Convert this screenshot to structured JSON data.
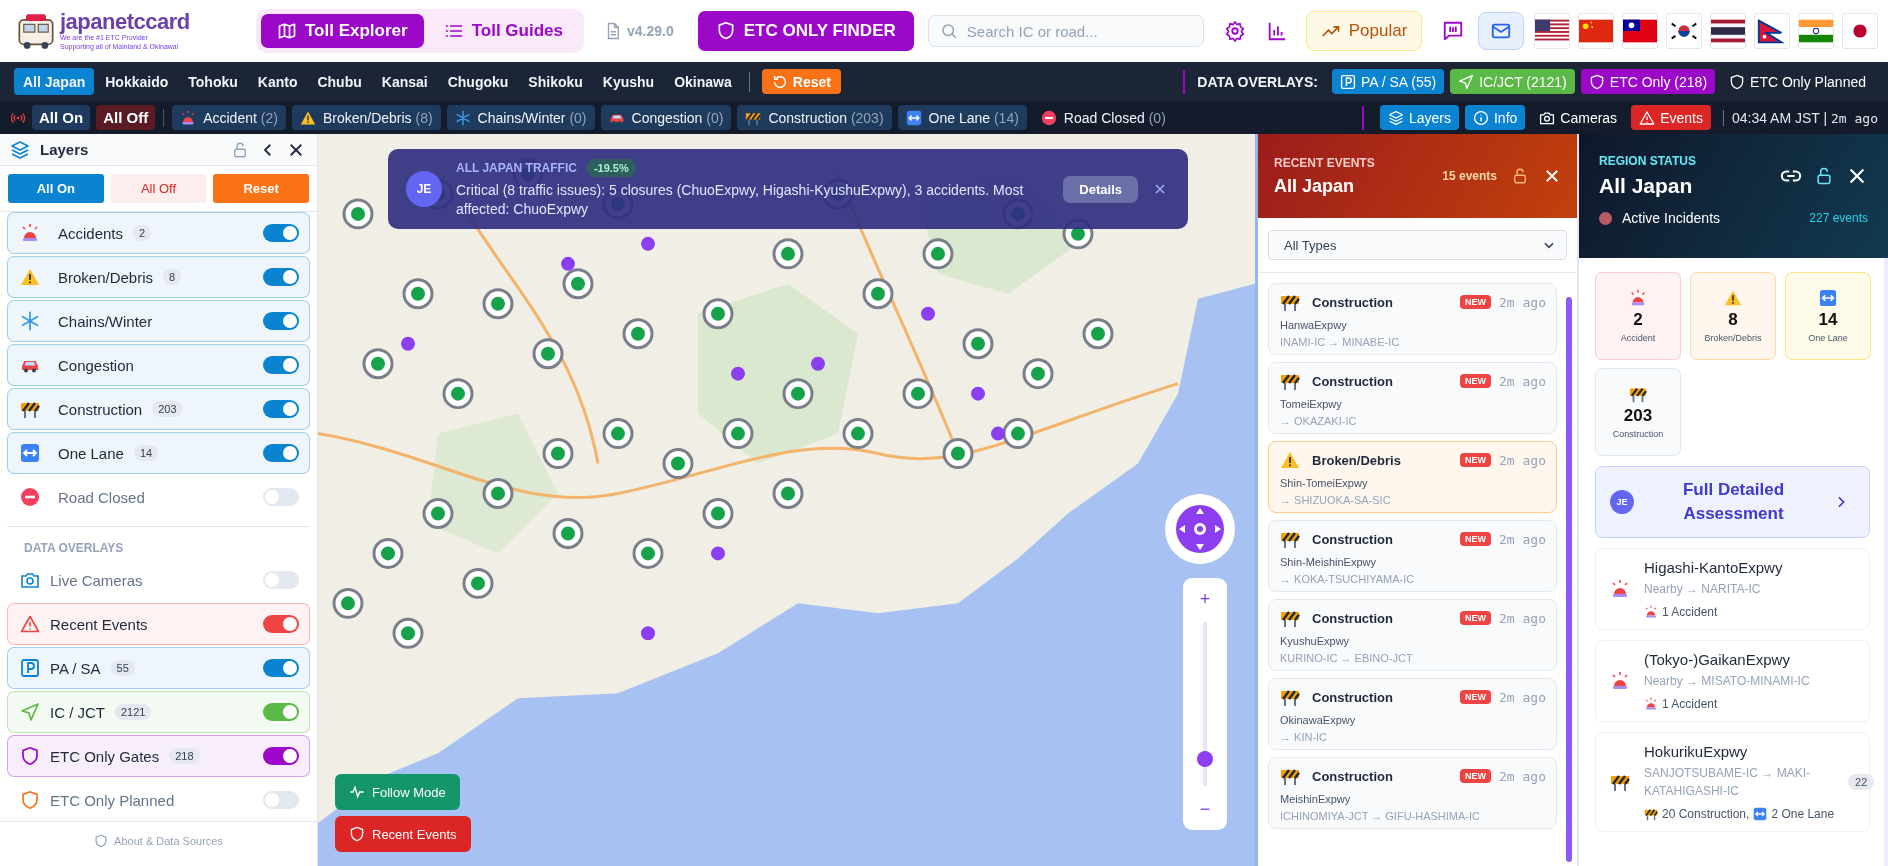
{
  "header": {
    "logo": {
      "brand": "japanetccard",
      "tagline": [
        "We are the #1 ETC Provider",
        "Supporting all of Mainland & Okinawa!"
      ]
    },
    "nav_tabs": [
      {
        "label": "Toll Explorer",
        "kind": "map",
        "selected": true
      },
      {
        "label": "Toll Guides",
        "kind": "list",
        "selected": false
      }
    ],
    "version": "v4.29.0",
    "finder_button": "ETC ONLY FINDER",
    "search": {
      "placeholder": "Search IC or road..."
    },
    "popular_button": "Popular"
  },
  "regions": [
    {
      "label": "All Japan",
      "selected": true
    },
    {
      "label": "Hokkaido",
      "selected": false
    },
    {
      "label": "Tohoku",
      "selected": false
    },
    {
      "label": "Kanto",
      "selected": false
    },
    {
      "label": "Chubu",
      "selected": false
    },
    {
      "label": "Kansai",
      "selected": false
    },
    {
      "label": "Chugoku",
      "selected": false
    },
    {
      "label": "Shikoku",
      "selected": false
    },
    {
      "label": "Kyushu",
      "selected": false
    },
    {
      "label": "Okinawa",
      "selected": false
    }
  ],
  "reset_button": "Reset",
  "overlay_bar": {
    "label": "DATA OVERLAYS:",
    "items": [
      {
        "kind": "parking",
        "label": "PA / SA",
        "count": "(55)",
        "on": true,
        "color": "#0a84d0"
      },
      {
        "kind": "ic",
        "label": "IC/JCT",
        "count": "(2121)",
        "on": true,
        "color": "#5bb947"
      },
      {
        "kind": "etc",
        "label": "ETC Only",
        "count": "(218)",
        "on": true,
        "color": "#9b08c8"
      },
      {
        "kind": "etc",
        "label": "ETC Only Planned",
        "on": false
      }
    ]
  },
  "filter_bar": {
    "all_on": "All On",
    "all_off": "All Off",
    "items": [
      {
        "kind": "accident",
        "label": "Accident",
        "count": "(2)",
        "on": true
      },
      {
        "kind": "debris",
        "label": "Broken/Debris",
        "count": "(8)",
        "on": true
      },
      {
        "kind": "chains",
        "label": "Chains/Winter",
        "count": "(0)",
        "on": true
      },
      {
        "kind": "congestion",
        "label": "Congestion",
        "count": "(0)",
        "on": true
      },
      {
        "kind": "construction",
        "label": "Construction",
        "count": "(203)",
        "on": true
      },
      {
        "kind": "one_lane",
        "label": "One Lane",
        "count": "(14)",
        "on": true
      },
      {
        "kind": "closed",
        "label": "Road Closed",
        "count": "(0)",
        "on": false
      }
    ],
    "tools": [
      {
        "kind": "layers",
        "label": "Layers",
        "on": true,
        "color": "#0a84d0"
      },
      {
        "kind": "info",
        "label": "Info",
        "on": true,
        "color": "#0a84d0"
      },
      {
        "kind": "camera",
        "label": "Cameras",
        "on": false
      },
      {
        "kind": "warning",
        "label": "Events",
        "on": true,
        "color": "#dc2626"
      }
    ],
    "clock": "04:34 AM JST |",
    "updated": "2m ago"
  },
  "layers_panel": {
    "title": "Layers",
    "all_on": "All On",
    "all_off": "All Off",
    "reset": "Reset",
    "incidents": [
      {
        "kind": "accident",
        "label": "Accidents",
        "count": "2",
        "on": true
      },
      {
        "kind": "debris",
        "label": "Broken/Debris",
        "count": "8",
        "on": true
      },
      {
        "kind": "chains",
        "label": "Chains/Winter",
        "on": true
      },
      {
        "kind": "congestion",
        "label": "Congestion",
        "on": true
      },
      {
        "kind": "construction",
        "label": "Construction",
        "count": "203",
        "on": true
      },
      {
        "kind": "one_lane",
        "label": "One Lane",
        "count": "14",
        "on": true
      },
      {
        "kind": "closed",
        "label": "Road Closed",
        "on": false
      }
    ],
    "overlays_title": "DATA OVERLAYS",
    "overlays": [
      {
        "kind": "camera",
        "label": "Live Cameras",
        "on": false
      },
      {
        "kind": "events",
        "label": "Recent Events",
        "on": true,
        "color": "#ef4444"
      },
      {
        "kind": "parking",
        "label": "PA / SA",
        "count": "55",
        "on": true,
        "color": "#0a84d0"
      },
      {
        "kind": "ic",
        "label": "IC / JCT",
        "count": "2121",
        "on": true,
        "color": "#5bb947"
      },
      {
        "kind": "etc",
        "label": "ETC Only Gates",
        "count": "218",
        "on": true,
        "color": "#9b08c8"
      },
      {
        "kind": "etc_planned",
        "label": "ETC Only Planned",
        "on": false
      }
    ],
    "footer": "About & Data Sources"
  },
  "map": {
    "notification": {
      "title": "ALL JAPAN TRAFFIC",
      "change": "-19.5%",
      "avatar": "JE",
      "message": "Critical (8 traffic issues): 5 closures (ChuoExpwy, Higashi-KyushuExpwy), 3 accidents. Most affected: ChuoExpwy",
      "button": "Details"
    },
    "zoom": {
      "in": "+",
      "out": "−",
      "level": 0.13
    },
    "follow_button": "Follow Mode",
    "events_button": "Recent Events"
  },
  "events_panel": {
    "eyebrow": "RECENT EVENTS",
    "title": "All Japan",
    "count": "15 events",
    "filter": "All Types",
    "events": [
      {
        "kind": "construction",
        "title": "Construction",
        "badge": "NEW",
        "time": "2m ago",
        "road": "HanwaExpwy",
        "route": "INAMI-IC → MINABE-IC"
      },
      {
        "kind": "construction",
        "title": "Construction",
        "badge": "NEW",
        "time": "2m ago",
        "road": "TomeiExpwy",
        "route": "→ OKAZAKI-IC"
      },
      {
        "kind": "debris",
        "title": "Broken/Debris",
        "badge": "NEW",
        "time": "2m ago",
        "road": "Shin-TomeiExpwy",
        "route": "→ SHIZUOKA-SA-SIC"
      },
      {
        "kind": "construction",
        "title": "Construction",
        "badge": "NEW",
        "time": "2m ago",
        "road": "Shin-MeishinExpwy",
        "route": "→ KOKA-TSUCHIYAMA-IC"
      },
      {
        "kind": "construction",
        "title": "Construction",
        "badge": "NEW",
        "time": "2m ago",
        "road": "KyushuExpwy",
        "route": "KURINO-IC → EBINO-JCT"
      },
      {
        "kind": "construction",
        "title": "Construction",
        "badge": "NEW",
        "time": "2m ago",
        "road": "OkinawaExpwy",
        "route": "→ KIN-IC"
      },
      {
        "kind": "construction",
        "title": "Construction",
        "badge": "NEW",
        "time": "2m ago",
        "road": "MeishinExpwy",
        "route": "ICHINOMIYA-JCT → GIFU-HASHIMA-IC"
      }
    ]
  },
  "status_panel": {
    "eyebrow": "REGION STATUS",
    "title": "All Japan",
    "incidents_label": "Active Incidents",
    "events_count": "227 events",
    "stats": [
      {
        "kind": "accident",
        "value": "2",
        "label": "Accident"
      },
      {
        "kind": "debris",
        "value": "8",
        "label": "Broken/Debris"
      },
      {
        "kind": "one_lane",
        "value": "14",
        "label": "One Lane"
      },
      {
        "kind": "construction",
        "value": "203",
        "label": "Construction"
      }
    ],
    "assessment": {
      "avatar": "JE",
      "label": "Full Detailed Assessment"
    },
    "roads": [
      {
        "kind": "accident",
        "name": "Higashi-KantoExpwy",
        "route": "Nearby → NARITA-IC",
        "summary": [
          {
            "kind": "accident",
            "text": "1 Accident"
          }
        ]
      },
      {
        "kind": "accident",
        "name": "(Tokyo-)GaikanExpwy",
        "route": "Nearby → MISATO-MINAMI-IC",
        "summary": [
          {
            "kind": "accident",
            "text": "1 Accident"
          }
        ]
      },
      {
        "kind": "construction",
        "name": "HokurikuExpwy",
        "route": "SANJOTSUBAME-IC → MAKI-KATAHIGASHI-IC",
        "count": "22",
        "summary": [
          {
            "kind": "construction",
            "text": "20 Construction,"
          },
          {
            "kind": "one_lane",
            "text": "2 One Lane"
          }
        ]
      }
    ]
  }
}
